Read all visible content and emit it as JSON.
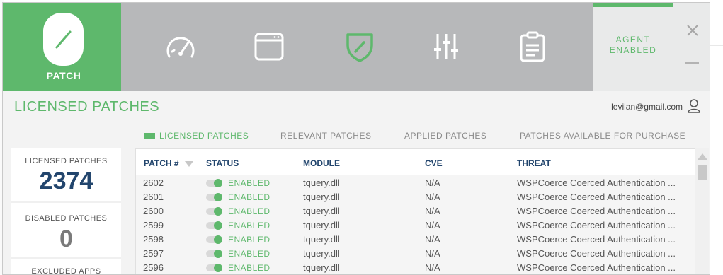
{
  "app": {
    "name": "PATCH"
  },
  "nav_icons": [
    "speedometer-icon",
    "browser-window-icon",
    "shield-patch-icon",
    "sliders-icon",
    "clipboard-icon"
  ],
  "agent": {
    "line1": "AGENT",
    "line2": "ENABLED"
  },
  "header": {
    "title": "LICENSED PATCHES",
    "email": "levilan@gmail.com"
  },
  "tabs": [
    {
      "label": "LICENSED PATCHES",
      "active": true
    },
    {
      "label": "RELEVANT PATCHES",
      "active": false
    },
    {
      "label": "APPLIED PATCHES",
      "active": false
    },
    {
      "label": "PATCHES AVAILABLE FOR PURCHASE",
      "active": false
    }
  ],
  "stats": {
    "licensed_label": "LICENSED PATCHES",
    "licensed_value": "2374",
    "disabled_label": "DISABLED PATCHES",
    "disabled_value": "0",
    "excluded_label": "EXCLUDED APPS"
  },
  "table": {
    "columns": [
      "PATCH #",
      "STATUS",
      "MODULE",
      "CVE",
      "THREAT"
    ],
    "rows": [
      {
        "patch": "2602",
        "status": "ENABLED",
        "module": "tquery.dll",
        "cve": "N/A",
        "threat": "WSPCoerce Coerced Authentication ..."
      },
      {
        "patch": "2601",
        "status": "ENABLED",
        "module": "tquery.dll",
        "cve": "N/A",
        "threat": "WSPCoerce Coerced Authentication ..."
      },
      {
        "patch": "2600",
        "status": "ENABLED",
        "module": "tquery.dll",
        "cve": "N/A",
        "threat": "WSPCoerce Coerced Authentication ..."
      },
      {
        "patch": "2599",
        "status": "ENABLED",
        "module": "tquery.dll",
        "cve": "N/A",
        "threat": "WSPCoerce Coerced Authentication ..."
      },
      {
        "patch": "2598",
        "status": "ENABLED",
        "module": "tquery.dll",
        "cve": "N/A",
        "threat": "WSPCoerce Coerced Authentication ..."
      },
      {
        "patch": "2597",
        "status": "ENABLED",
        "module": "tquery.dll",
        "cve": "N/A",
        "threat": "WSPCoerce Coerced Authentication ..."
      },
      {
        "patch": "2596",
        "status": "ENABLED",
        "module": "tquery.dll",
        "cve": "N/A",
        "threat": "WSPCoerce Coerced Authentication ..."
      }
    ]
  },
  "colors": {
    "brand_green": "#5eb86c",
    "topbar_gray": "#b7b8ba",
    "stat_blue": "#22456d",
    "stat_gray": "#7a7a7a"
  }
}
